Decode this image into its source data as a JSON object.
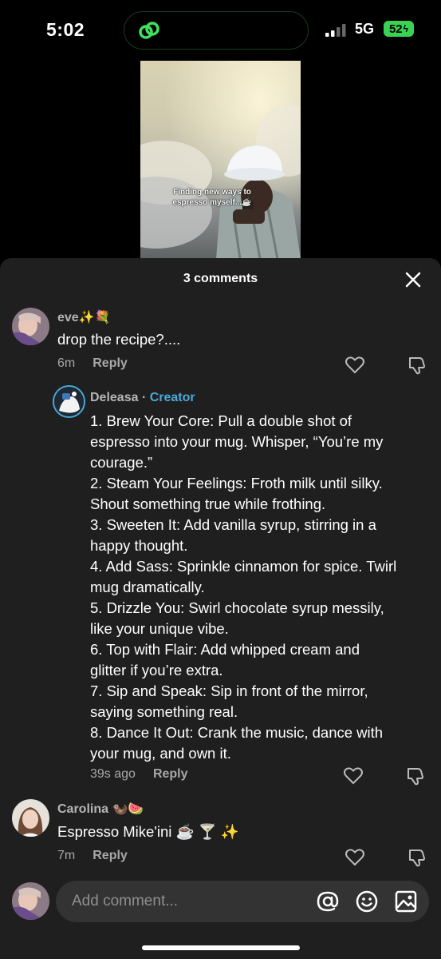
{
  "status_bar": {
    "time": "5:02",
    "network": "5G",
    "battery": "52"
  },
  "video": {
    "caption": "Finding new ways to espresso myself...☕"
  },
  "sheet": {
    "title": "3 comments"
  },
  "comments": [
    {
      "username": "eve✨💐",
      "text": "drop the recipe?....",
      "time": "6m",
      "reply_label": "Reply"
    },
    {
      "username": "Deleasa",
      "badge": "Creator",
      "separator": " · ",
      "lines": [
        "1. Brew Your Core: Pull a double shot of",
        "espresso into your mug. Whisper, “You’re my",
        "courage.”",
        "2. Steam Your Feelings: Froth milk until silky.",
        "Shout something true while frothing.",
        "3. Sweeten It: Add vanilla syrup, stirring in a",
        "happy thought.",
        "4. Add Sass: Sprinkle cinnamon for spice. Twirl",
        "mug dramatically.",
        "5. Drizzle You: Swirl chocolate syrup messily,",
        "like your unique vibe.",
        "6. Top with Flair: Add whipped cream and",
        "glitter if you’re extra.",
        "7. Sip and Speak: Sip in front of the mirror,",
        "saying something real.",
        "8. Dance It Out: Crank the music, dance with",
        "your mug, and own it."
      ],
      "time": "39s ago",
      "reply_label": "Reply"
    },
    {
      "username": "Carolina 🦦🍉",
      "text": "Espresso Mike'ini ☕ 🍸 ✨",
      "time": "7m",
      "reply_label": "Reply"
    }
  ],
  "input": {
    "placeholder": "Add comment..."
  },
  "colors": {
    "sheet_bg": "#1f1f1f",
    "creator_accent": "#4aa8d8",
    "battery_green": "#39d353"
  }
}
